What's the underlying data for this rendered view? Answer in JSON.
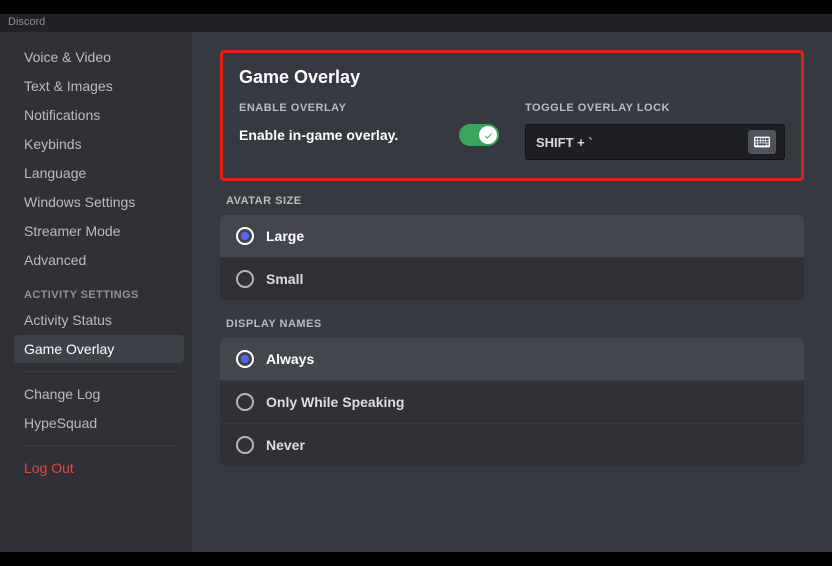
{
  "app": {
    "title": "Discord"
  },
  "sidebar": {
    "items": [
      {
        "label": "Voice & Video"
      },
      {
        "label": "Text & Images"
      },
      {
        "label": "Notifications"
      },
      {
        "label": "Keybinds"
      },
      {
        "label": "Language"
      },
      {
        "label": "Windows Settings"
      },
      {
        "label": "Streamer Mode"
      },
      {
        "label": "Advanced"
      }
    ],
    "activity_header": "ACTIVITY SETTINGS",
    "activity_items": [
      {
        "label": "Activity Status"
      },
      {
        "label": "Game Overlay",
        "selected": true
      }
    ],
    "misc_items": [
      {
        "label": "Change Log"
      },
      {
        "label": "HypeSquad"
      }
    ],
    "logout": "Log Out"
  },
  "overlay": {
    "title": "Game Overlay",
    "enable_label": "ENABLE OVERLAY",
    "enable_text": "Enable in-game overlay.",
    "enable_value": true,
    "lock_label": "TOGGLE OVERLAY LOCK",
    "lock_keybind": "SHIFT + `"
  },
  "avatar": {
    "label": "AVATAR SIZE",
    "options": [
      "Large",
      "Small"
    ],
    "selected": "Large"
  },
  "display_names": {
    "label": "DISPLAY NAMES",
    "options": [
      "Always",
      "Only While Speaking",
      "Never"
    ],
    "selected": "Always"
  }
}
